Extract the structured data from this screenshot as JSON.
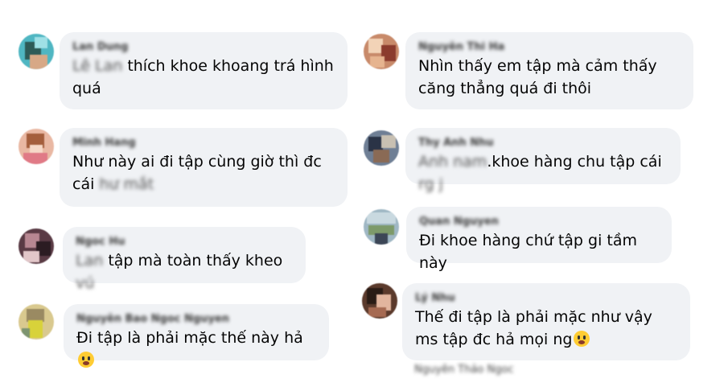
{
  "comments": [
    {
      "name": "Lan Dung",
      "pre": "Lê Lan",
      "text": "thích khoe khoang trá hình quá",
      "post": ""
    },
    {
      "name": "Nguyễn Thi Ha",
      "pre": "",
      "text": "Nhìn thấy em tập mà cảm thấy căng thẳng quá đi thôi",
      "post": ""
    },
    {
      "name": "Minh Hang",
      "pre": "",
      "text": "Như này ai đi tập cùng giờ thì đc cái",
      "post": "hư mắt"
    },
    {
      "name": "Thy Anh Nhu",
      "pre": "Anh nam",
      "text": ".khoe hàng chu tập cái",
      "post": "rg j"
    },
    {
      "name": "Ngoc Hu",
      "pre": "Lan",
      "text": "tập mà toàn thấy kheo",
      "post": "vú"
    },
    {
      "name": "Quan Nguyen",
      "pre": "",
      "text": "Đi khoe hàng chứ tập gi tầm này",
      "post": ""
    },
    {
      "name": "Nguyễn Bao Ngoc Nguyen",
      "pre": "",
      "text": "Đi tập là phải mặc thế này hả",
      "post": ""
    },
    {
      "name": "Lý Nhu",
      "pre": "",
      "text": "Thế đi tập là phải mặc như vậy ms tập đc hả mọi ng",
      "post": ""
    }
  ],
  "partial_text": "Nguyễn Thảo Ngoc"
}
